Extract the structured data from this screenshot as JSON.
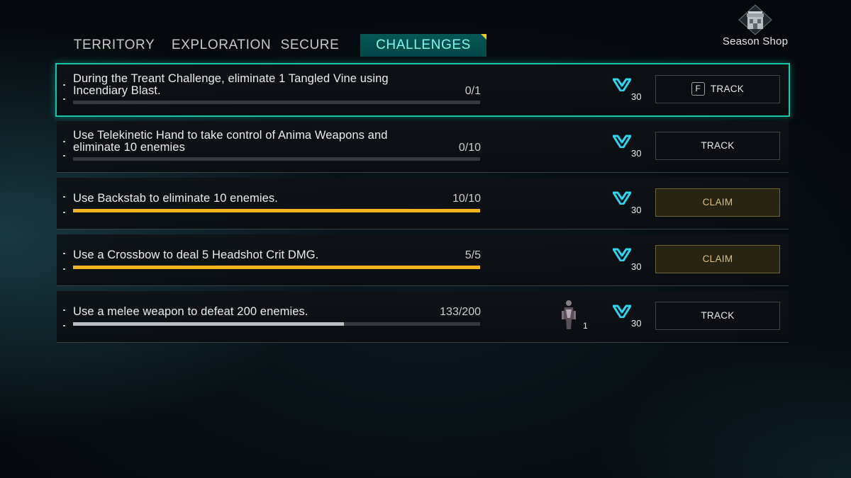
{
  "tabs": [
    {
      "label": "TERRITORY",
      "active": false
    },
    {
      "label": "EXPLORATION",
      "active": false
    },
    {
      "label": "SECURE",
      "active": false
    },
    {
      "label": "CHALLENGES",
      "active": true
    }
  ],
  "season_shop": {
    "label": "Season Shop",
    "icon": "shop-building-icon"
  },
  "challenges": [
    {
      "line1": "During the Treant Challenge, eliminate 1 Tangled Vine using",
      "line2": "Incendiary Blast.",
      "progress_text": "0/1",
      "progress_fraction": 0.0,
      "reward_icon": "season-currency-icon",
      "reward_amount": "30",
      "button_label": "TRACK",
      "button_key": "F",
      "selected": true
    },
    {
      "line1": "Use Telekinetic Hand to take control of Anima Weapons and",
      "line2": "eliminate 10 enemies",
      "progress_text": "0/10",
      "progress_fraction": 0.0,
      "reward_icon": "season-currency-icon",
      "reward_amount": "30",
      "button_label": "TRACK"
    },
    {
      "line1": "Use Backstab to eliminate 10 enemies.",
      "progress_text": "10/10",
      "progress_fraction": 1.0,
      "reward_icon": "season-currency-icon",
      "reward_amount": "30",
      "button_label": "CLAIM"
    },
    {
      "line1": "Use a Crossbow to deal 5 Headshot Crit DMG.",
      "progress_text": "5/5",
      "progress_fraction": 1.0,
      "reward_icon": "season-currency-icon",
      "reward_amount": "30",
      "button_label": "CLAIM"
    },
    {
      "line1": "Use a melee weapon to defeat 200 enemies.",
      "progress_text": "133/200",
      "progress_fraction": 0.665,
      "extra_reward_icon": "character-figure-icon",
      "extra_reward_amount": "1",
      "reward_icon": "season-currency-icon",
      "reward_amount": "30",
      "button_label": "TRACK"
    }
  ],
  "colors": {
    "accent_teal": "#19c4a8",
    "progress_gold": "#f1b41c",
    "claim_text": "#ddc27a"
  }
}
